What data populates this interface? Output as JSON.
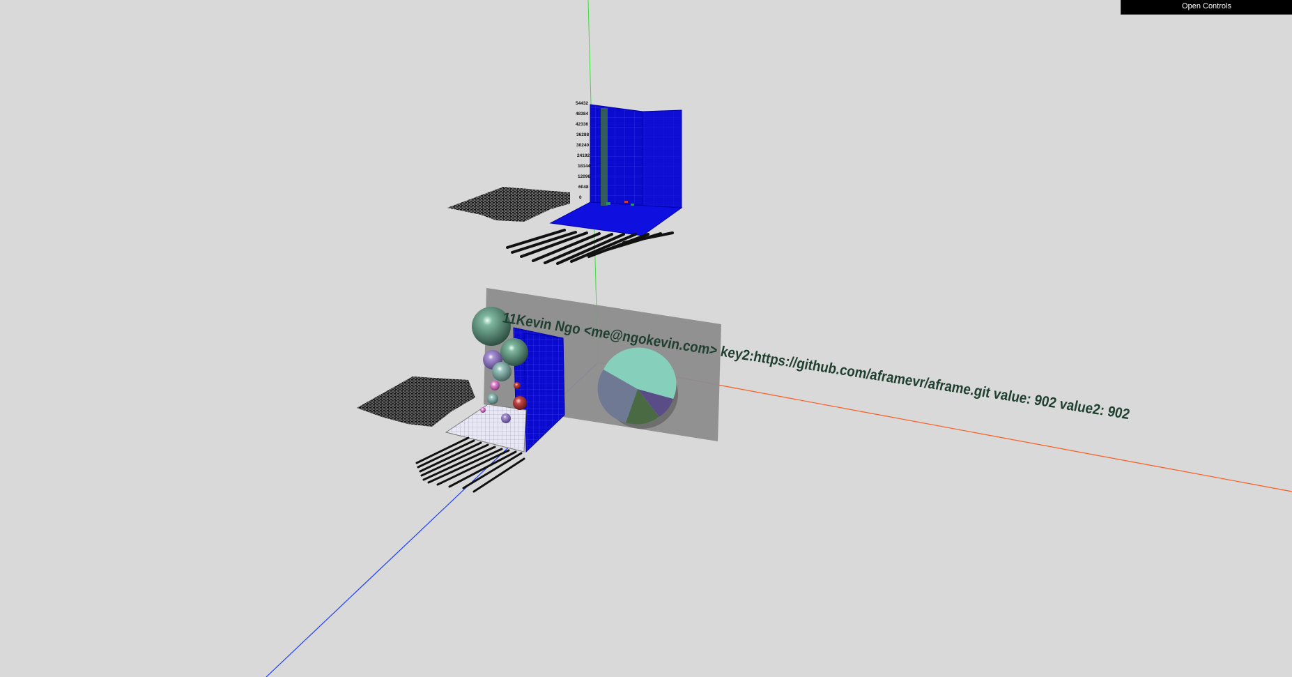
{
  "controls": {
    "open_label": "Open Controls"
  },
  "tooltip": {
    "text": "11Kevin Ngo <me@ngokevin.com> key2:https://github.com/aframevr/aframe.git value: 902 value2: 902"
  },
  "upper_chart": {
    "y_ticks": [
      "54432",
      "48384",
      "42336",
      "36288",
      "30240",
      "24192",
      "18144",
      "12096",
      "6048",
      "0"
    ]
  },
  "colors": {
    "background": "#d9d9d9",
    "grid_blue": "#0a0acc",
    "axis_x": "#ff4a1a",
    "axis_y": "#33dd33",
    "axis_z": "#1a3cff",
    "panel": "#8a8a8a",
    "pie_teal": "#7fc9b3",
    "text_dark_green": "#1f3f30"
  },
  "icons": {
    "spheres": "sphere-glyph"
  }
}
